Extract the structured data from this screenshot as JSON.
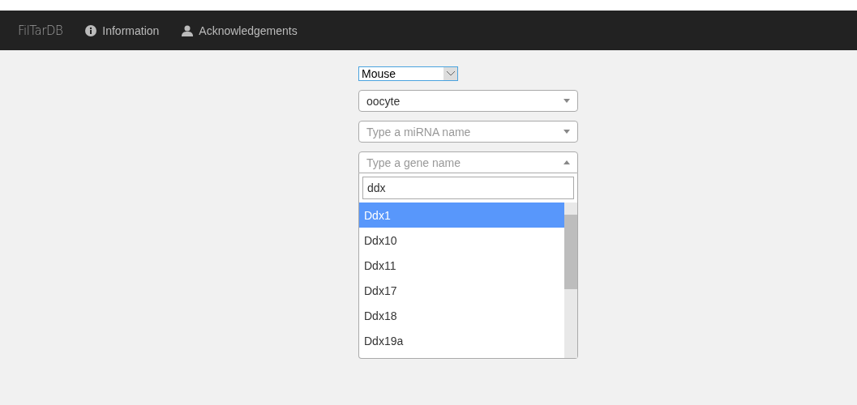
{
  "navbar": {
    "brand": "FilTarDB",
    "items": [
      {
        "label": "Information",
        "kind": "info"
      },
      {
        "label": "Acknowledgements",
        "kind": "user"
      }
    ]
  },
  "species_select": {
    "value": "Mouse"
  },
  "tissue_select": {
    "value": "oocyte"
  },
  "mirna_select": {
    "placeholder": "Type a miRNA name",
    "expanded": false
  },
  "gene_select": {
    "placeholder": "Type a gene name",
    "expanded": true,
    "search": {
      "value": "ddx"
    },
    "options": [
      {
        "label": "Ddx1",
        "selected": true
      },
      {
        "label": "Ddx10",
        "selected": false
      },
      {
        "label": "Ddx11",
        "selected": false
      },
      {
        "label": "Ddx17",
        "selected": false
      },
      {
        "label": "Ddx18",
        "selected": false
      },
      {
        "label": "Ddx19a",
        "selected": false
      }
    ]
  }
}
